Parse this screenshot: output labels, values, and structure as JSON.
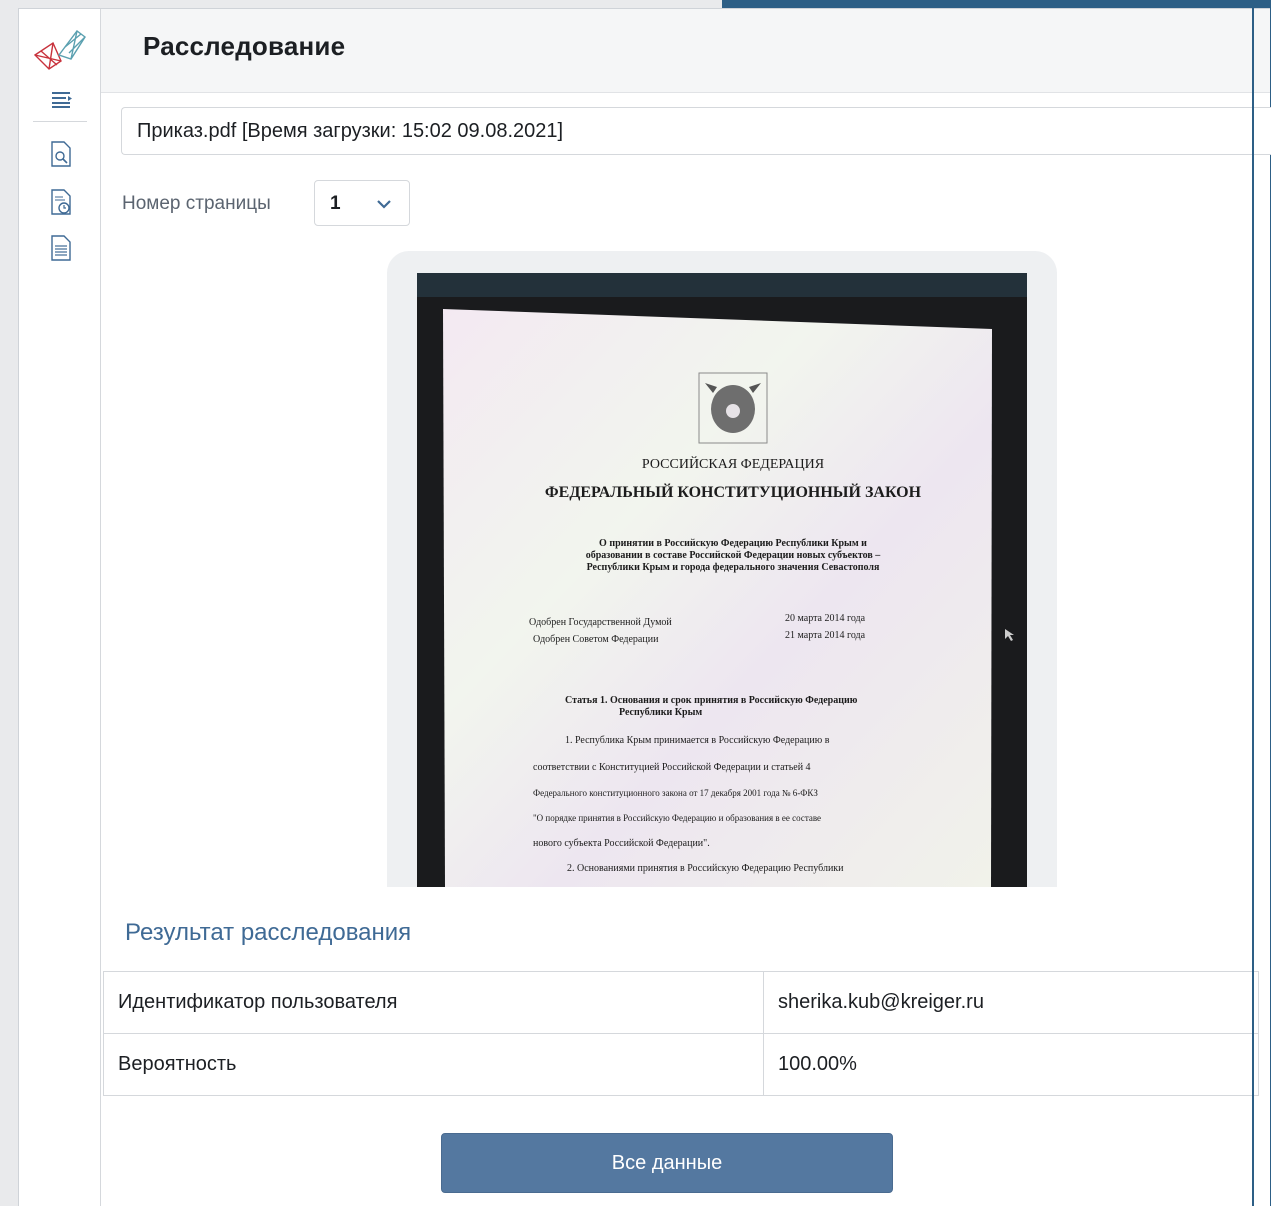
{
  "header": {
    "title": "Расследование"
  },
  "sidebar": {
    "items": [
      {
        "icon": "menu-toggle-icon"
      },
      {
        "icon": "document-search-icon"
      },
      {
        "icon": "document-clock-icon"
      },
      {
        "icon": "document-text-icon"
      }
    ]
  },
  "file": {
    "selected": "Приказ.pdf [Время загрузки: 15:02 09.08.2021]"
  },
  "pagination": {
    "label": "Номер страницы",
    "selected": "1"
  },
  "document_preview": {
    "line1": "РОССИЙСКАЯ ФЕДЕРАЦИЯ",
    "line2": "ФЕДЕРАЛЬНЫЙ КОНСТИТУЦИОННЫЙ ЗАКОН",
    "subtitle1": "О принятии в Российскую Федерацию Республики Крым и",
    "subtitle2": "образовании в составе Российской Федерации новых субъектов –",
    "subtitle3": "Республики Крым и города федерального значения Севастополя",
    "approved1_left": "Одобрен Государственной Думой",
    "approved1_right": "20 марта 2014 года",
    "approved2_left": "Одобрен Советом Федерации",
    "approved2_right": "21 марта 2014 года",
    "article1": "Статья 1. Основания и срок принятия в Российскую Федерацию",
    "article1b": "Республики Крым",
    "p1": "1. Республика Крым принимается в Российскую Федерацию в",
    "p2": "соответствии с Конституцией Российской Федерации и статьей 4",
    "p3": "Федерального конституционного закона от 17 декабря 2001 года № 6-ФКЗ",
    "p4": "\"О порядке принятия в Российскую Федерацию и образования в ее составе",
    "p5": "нового субъекта Российской Федерации\".",
    "p6": "2. Основаниями принятия в Российскую Федерацию Республики"
  },
  "result": {
    "title": "Результат расследования",
    "rows": [
      {
        "label": "Идентификатор пользователя",
        "value": "sherika.kub@kreiger.ru"
      },
      {
        "label": "Вероятность",
        "value": "100.00%"
      }
    ]
  },
  "actions": {
    "all_data_label": "Все данные"
  },
  "colors": {
    "accent": "#5478a0",
    "title_blue": "#3f6a95",
    "frame": "#2d5f86"
  }
}
